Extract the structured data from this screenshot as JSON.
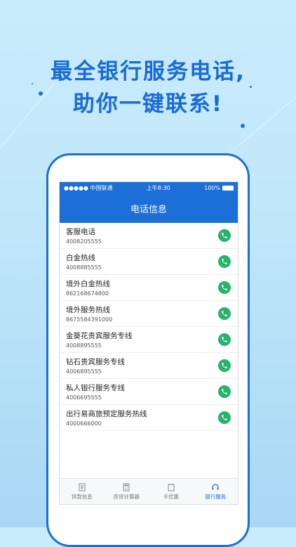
{
  "headline": {
    "line1": "最全银行服务电话,",
    "line2": "助你一键联系!"
  },
  "status_bar": {
    "carrier": "●●●●● 中国联通",
    "time": "上午8:30",
    "battery": "100%"
  },
  "nav": {
    "title": "电话信息"
  },
  "contacts": [
    {
      "title": "客服电话",
      "number": "4008205555"
    },
    {
      "title": "白金热线",
      "number": "4008885555"
    },
    {
      "title": "境外白金热线",
      "number": "862168674800"
    },
    {
      "title": "境外服务热线",
      "number": "8675584391000"
    },
    {
      "title": "金葵花贵宾服务专线",
      "number": "4008895555"
    },
    {
      "title": "钻石贵宾服务专线",
      "number": "4006895555"
    },
    {
      "title": "私人银行服务专线",
      "number": "4006695555"
    },
    {
      "title": "出行易商旅预定服务热线",
      "number": "4000666000"
    }
  ],
  "tabs": [
    {
      "label": "贷款信息",
      "icon": "document-icon"
    },
    {
      "label": "房贷计算器",
      "icon": "calculator-icon"
    },
    {
      "label": "卡优惠",
      "icon": "card-icon"
    },
    {
      "label": "银行服务",
      "icon": "headset-icon",
      "active": true
    }
  ],
  "colors": {
    "brand": "#1b6fd6",
    "call_button": "#27b36c",
    "headline": "#1a6ad6"
  }
}
